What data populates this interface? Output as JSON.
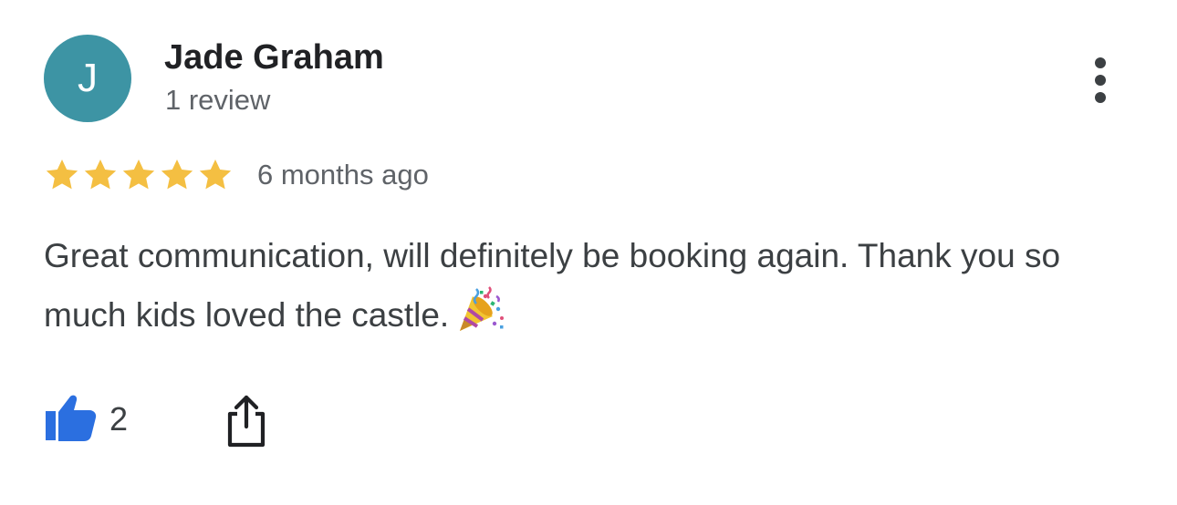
{
  "reviewer": {
    "initial": "J",
    "name": "Jade Graham",
    "review_count": "1 review",
    "avatar_color": "#3d94a4"
  },
  "rating": {
    "stars": 5,
    "max_stars": 5,
    "star_color": "#f4bf42",
    "date": "6 months ago"
  },
  "review": {
    "text": "Great communication, will definitely be booking again. Thank you so much kids loved the castle.",
    "emoji": "party-popper-icon"
  },
  "actions": {
    "like_icon": "thumbs-up-icon",
    "like_color": "#2b6fe0",
    "like_count": "2",
    "share_icon": "share-icon",
    "more_icon": "more-vertical-icon"
  }
}
